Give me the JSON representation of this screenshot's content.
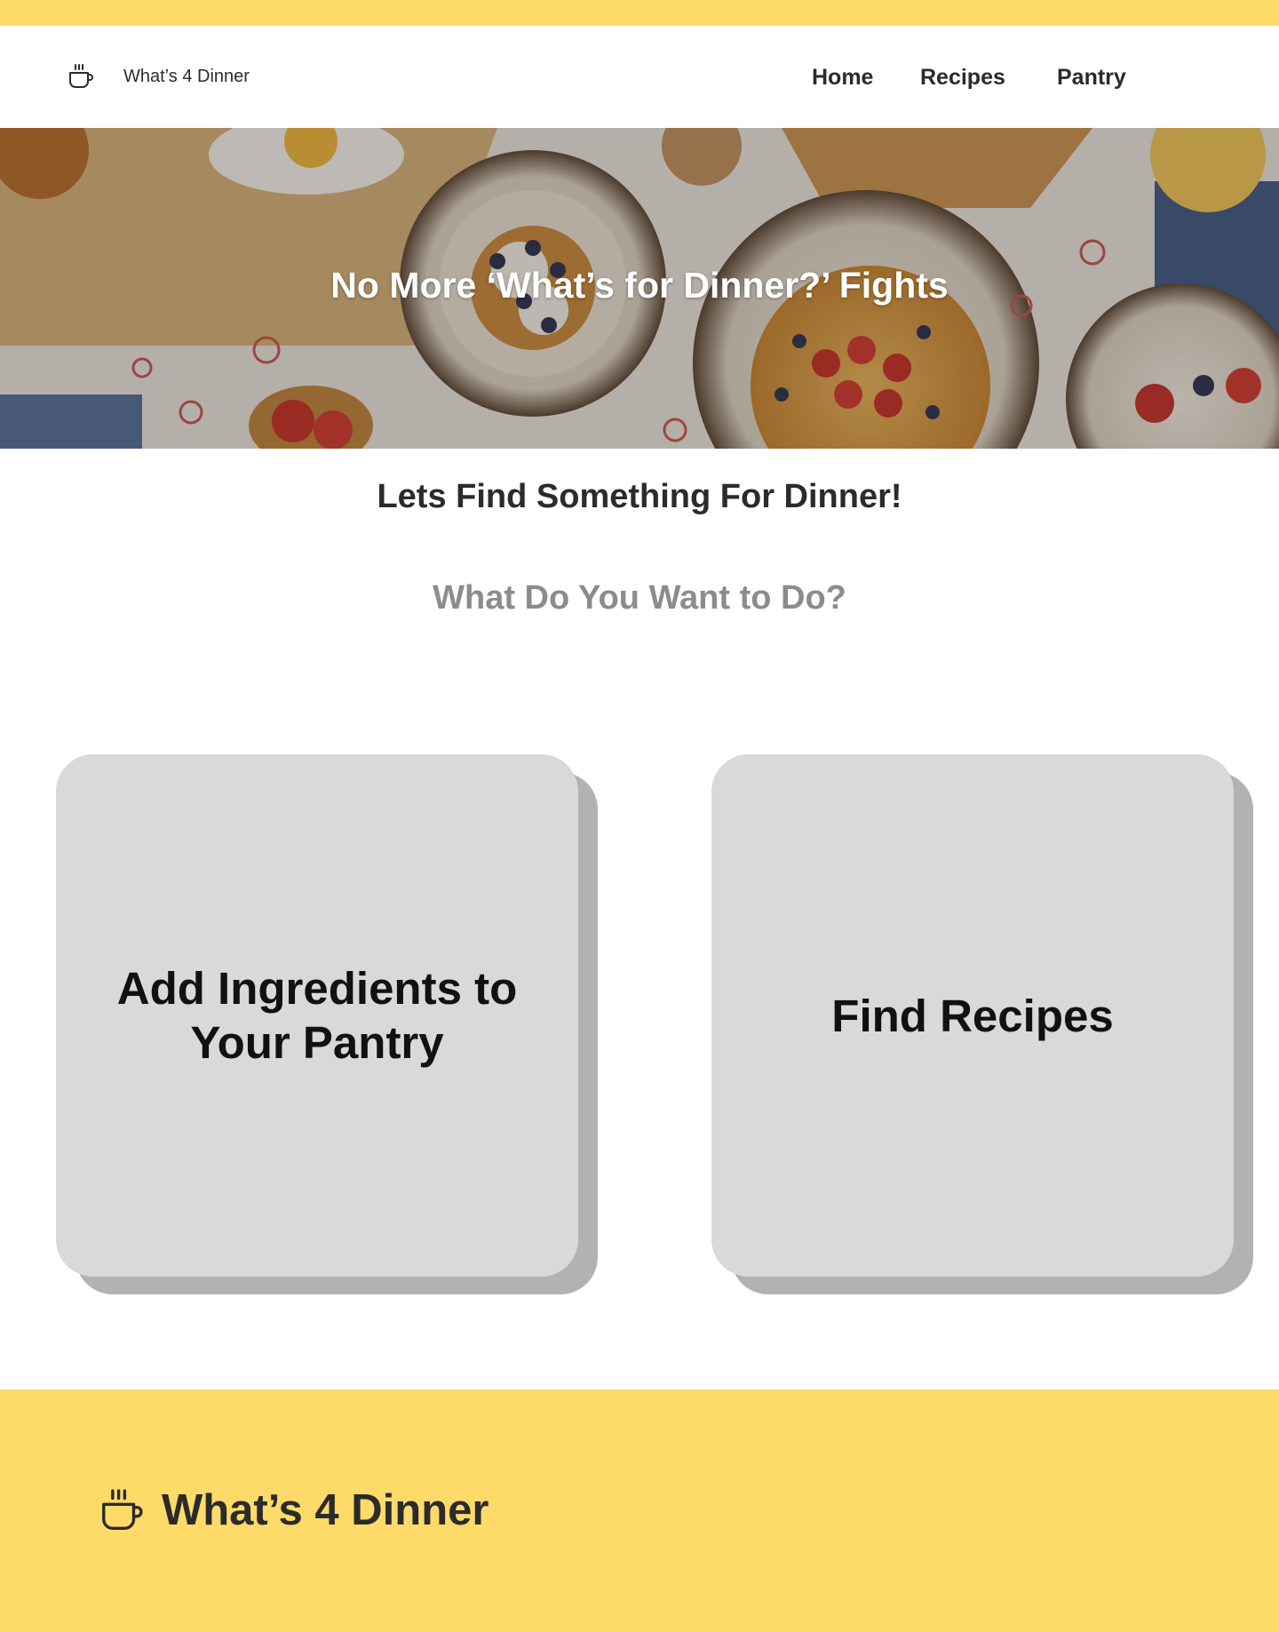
{
  "colors": {
    "accent_yellow": "#FEDB68",
    "card_bg": "#D9D9D9",
    "card_shadow": "#B2B2B2",
    "text_dark": "#2B2B2B",
    "text_muted": "#8C8C8C"
  },
  "header": {
    "logo_icon": "coffee-cup-icon",
    "brand_name": "What’s 4 Dinner",
    "nav": [
      {
        "label": "Home"
      },
      {
        "label": "Recipes"
      },
      {
        "label": "Pantry"
      }
    ]
  },
  "hero": {
    "title": "No More ‘What’s for Dinner?’ Fights",
    "image": "breakfast-table-photo"
  },
  "main": {
    "title": "Lets Find Something For Dinner!",
    "subtitle": "What Do You Want to Do?",
    "cards": [
      {
        "label": "Add Ingredients to Your Pantry"
      },
      {
        "label": "Find Recipes"
      }
    ]
  },
  "footer": {
    "logo_icon": "coffee-cup-icon",
    "brand_name": "What’s 4 Dinner"
  }
}
